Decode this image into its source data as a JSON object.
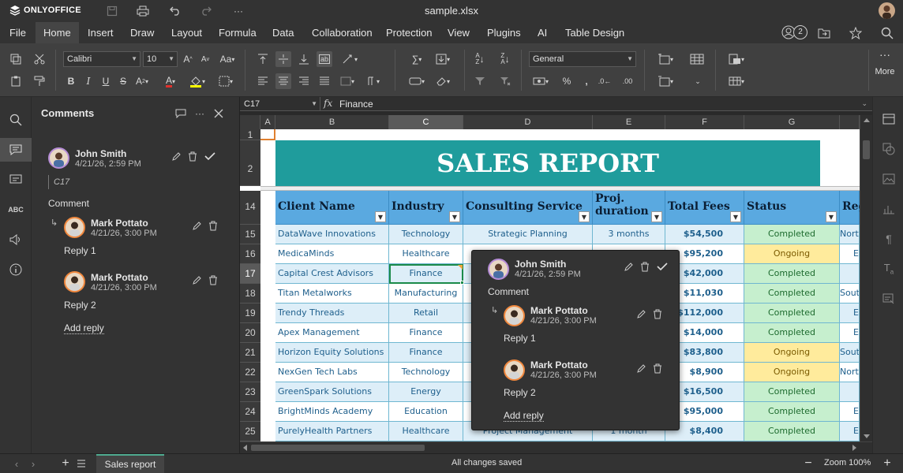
{
  "app": {
    "name": "ONLYOFFICE",
    "document_title": "sample.xlsx"
  },
  "menu": {
    "tabs": [
      "File",
      "Home",
      "Insert",
      "Draw",
      "Layout",
      "Formula",
      "Data",
      "Collaboration",
      "Protection",
      "View",
      "Plugins",
      "AI",
      "Table Design"
    ],
    "active": "Home",
    "users_count": "2"
  },
  "toolbar": {
    "font_name": "Calibri",
    "font_size": "10",
    "number_format": "General",
    "more_label": "More"
  },
  "panel": {
    "title": "Comments",
    "comment": {
      "author": "John Smith",
      "date": "4/21/26, 2:59 PM",
      "cell_ref": "C17",
      "text": "Comment",
      "replies": [
        {
          "author": "Mark Pottato",
          "date": "4/21/26, 3:00 PM",
          "text": "Reply 1"
        },
        {
          "author": "Mark Pottato",
          "date": "4/21/26, 3:00 PM",
          "text": "Reply 2"
        }
      ],
      "add_reply": "Add reply"
    }
  },
  "formula_bar": {
    "cell": "C17",
    "fx": "fx",
    "value": "Finance"
  },
  "sheet": {
    "columns": [
      "A",
      "B",
      "C",
      "D",
      "E",
      "F",
      "G"
    ],
    "row_numbers": [
      "1",
      "2",
      "14",
      "15",
      "16",
      "17",
      "18",
      "19",
      "20",
      "21",
      "22",
      "23",
      "24",
      "25"
    ],
    "title": "SALES REPORT",
    "headers": [
      "Client Name",
      "Industry",
      "Consulting Service",
      "Proj. duration",
      "Total Fees",
      "Status",
      "Region"
    ],
    "rows": [
      [
        "DataWave Innovations",
        "Technology",
        "Strategic Planning",
        "3 months",
        "$54,500",
        "Completed",
        "North"
      ],
      [
        "MedicaMinds",
        "Healthcare",
        "",
        "",
        "$95,200",
        "Ongoing",
        "E"
      ],
      [
        "Capital Crest Advisors",
        "Finance",
        "",
        "",
        "$42,000",
        "Completed",
        ""
      ],
      [
        "Titan Metalworks",
        "Manufacturing",
        "",
        "",
        "$11,030",
        "Completed",
        "South"
      ],
      [
        "Trendy Threads",
        "Retail",
        "",
        "",
        "$112,000",
        "Completed",
        "E"
      ],
      [
        "Apex Management",
        "Finance",
        "",
        "",
        "$14,000",
        "Completed",
        "E"
      ],
      [
        "Horizon Equity Solutions",
        "Finance",
        "",
        "",
        "$83,800",
        "Ongoing",
        "South"
      ],
      [
        "NexGen Tech Labs",
        "Technology",
        "",
        "",
        "$8,900",
        "Ongoing",
        "North"
      ],
      [
        "GreenSpark Solutions",
        "Energy",
        "",
        "",
        "$16,500",
        "Completed",
        ""
      ],
      [
        "BrightMinds Academy",
        "Education",
        "",
        "",
        "$95,000",
        "Completed",
        "E"
      ],
      [
        "PurelyHealth Partners",
        "Healthcare",
        "Project Management",
        "1 month",
        "$8,400",
        "Completed",
        "E"
      ]
    ]
  },
  "status_bar": {
    "sheet_tab": "Sales report",
    "status": "All changes saved",
    "zoom": "Zoom 100%"
  },
  "colors": {
    "title_band": "#1f9c9c",
    "header": "#5aa9e0",
    "completed": "#c6efce",
    "ongoing": "#ffeb9c",
    "row_alt": "#ddeef8"
  }
}
